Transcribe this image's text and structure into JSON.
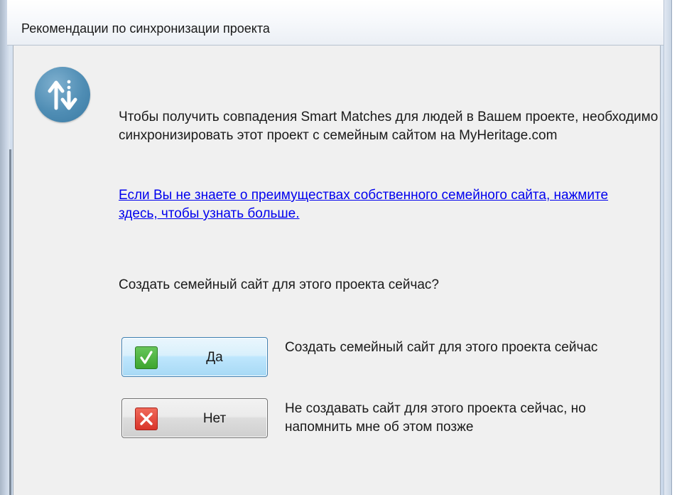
{
  "window": {
    "title": "Рекомендации по синхронизации проекта"
  },
  "dialog": {
    "icon": "sync-arrows-icon",
    "message": "Чтобы получить совпадения Smart Matches для людей в Вашем проекте, необходимо синхронизировать этот проект с семейным сайтом на MyHeritage.com",
    "link_text": "Если Вы не знаете о преимуществах собственного семейного сайта, нажмите здесь, чтобы узнать больше.",
    "question": "Создать семейный сайт для этого проекта сейчас?"
  },
  "buttons": {
    "yes": {
      "label": "Да",
      "icon": "checkmark-icon",
      "description": "Создать семейный сайт для этого проекта сейчас"
    },
    "no": {
      "label": "Нет",
      "icon": "cross-icon",
      "description": "Не создавать сайт для этого проекта сейчас, но напомнить мне об этом позже"
    }
  },
  "colors": {
    "link": "#0000ee",
    "icon_bg": "#4f8db4",
    "yes_icon": "#3da52f",
    "no_icon": "#d9342a"
  }
}
